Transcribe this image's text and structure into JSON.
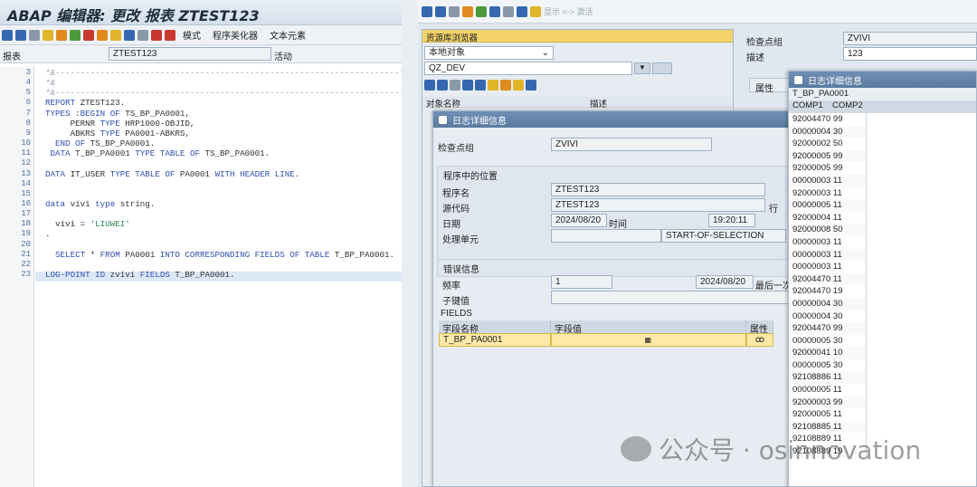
{
  "left": {
    "title": "ABAP 编辑器: 更改 报表 ZTEST123",
    "toolbar": {
      "mode": "模式",
      "pretty": "程序美化器",
      "text_elements": "文本元素"
    },
    "header": {
      "label": "报表",
      "program": "ZTEST123",
      "status": "活动"
    },
    "line_numbers": [
      "3",
      "4",
      "5",
      "6",
      "7",
      "8",
      "9",
      "10",
      "11",
      "12",
      "13",
      "14",
      "15",
      "16",
      "17",
      "18",
      "19",
      "20",
      "21",
      "22",
      "23"
    ],
    "code": [
      {
        "t": "*&---------------------------------------------------------------------*",
        "c": "cm"
      },
      {
        "t": "*&",
        "c": "cm"
      },
      {
        "t": "*&---------------------------------------------------------------------*",
        "c": "cm"
      },
      {
        "t": "REPORT ZTEST123.",
        "c": ""
      },
      {
        "t": "TYPES :BEGIN OF TS_BP_PA0001,",
        "c": ""
      },
      {
        "t": "     PERNR TYPE HRP1000-OBJID,",
        "c": ""
      },
      {
        "t": "     ABKRS TYPE PA0001-ABKRS,",
        "c": ""
      },
      {
        "t": "  END OF TS_BP_PA0001.",
        "c": ""
      },
      {
        "t": " DATA T_BP_PA0001 TYPE TABLE OF TS_BP_PA0001.",
        "c": ""
      },
      {
        "t": "",
        "c": ""
      },
      {
        "t": "DATA IT_USER TYPE TABLE OF PA0001 WITH HEADER LINE.",
        "c": ""
      },
      {
        "t": "",
        "c": ""
      },
      {
        "t": "",
        "c": ""
      },
      {
        "t": "data vivi type string.",
        "c": ""
      },
      {
        "t": "",
        "c": ""
      },
      {
        "t": "  vivi = 'LIUWEI'",
        "c": ""
      },
      {
        "t": ".",
        "c": ""
      },
      {
        "t": "",
        "c": ""
      },
      {
        "t": "  SELECT * FROM PA0001 INTO CORRESPONDING FIELDS OF TABLE T_BP_PA0001.",
        "c": ""
      },
      {
        "t": "",
        "c": ""
      },
      {
        "t": "LOG-POINT ID zvivi FIELDS T_BP_PA0001.",
        "c": ""
      }
    ]
  },
  "right": {
    "toolbar_text": "显示 <-> 激活",
    "repo": {
      "title": "资源库浏览器",
      "select": "本地对象",
      "input": "QZ_DEV",
      "col_name": "对象名称",
      "col_desc": "描述"
    },
    "top": {
      "checkpoint_label": "检查点组",
      "checkpoint_value": "ZVIVI",
      "desc_label": "描述",
      "desc_value": "123",
      "tab": "属性"
    },
    "log_window": {
      "title": "日志详细信息",
      "checkpoint_label": "检查点组",
      "checkpoint_value": "ZVIVI",
      "section_pos": "程序中的位置",
      "prog_label": "程序名",
      "prog_value": "ZTEST123",
      "src_label": "源代码",
      "src_value": "ZTEST123",
      "line_label": "行",
      "date_label": "日期",
      "date_value": "2024/08/20",
      "time_label": "时间",
      "time_value": "19:20:11",
      "unit_label": "处理单元",
      "unit_value": "START-OF-SELECTION",
      "section_err": "错误信息",
      "freq_label": "频率",
      "freq_value": "1",
      "freq_date": "2024/08/20",
      "last_label": "最后一次",
      "subkey_label": "子键值",
      "fields_label": "FIELDS",
      "col_field": "字段名称",
      "col_value": "字段值",
      "col_attr": "属性",
      "row_field": "T_BP_PA0001"
    },
    "detail_window": {
      "title": "日志详细信息",
      "table_name": "T_BP_PA0001",
      "col1": "COMP1",
      "col2": "COMP2",
      "rows": [
        "92004470 99",
        "00000004 30",
        "92000002 50",
        "92000005 99",
        "92000005 99",
        "00000003 11",
        "92000003 11",
        "00000005 11",
        "92000004 11",
        "92000008 50",
        "00000003 11",
        "00000003 11",
        "00000003 11",
        "92004470 11",
        "92004470 19",
        "00000004 30",
        "00000004 30",
        "92004470 99",
        "00000005 30",
        "92000041 10",
        "00000005 30",
        "92108886 11",
        "00000005 11",
        "92000003 99",
        "92000005 11",
        "92108885 11",
        "92108889 11",
        "92108889 19"
      ]
    }
  },
  "watermark": "公众号 · osinnovation"
}
